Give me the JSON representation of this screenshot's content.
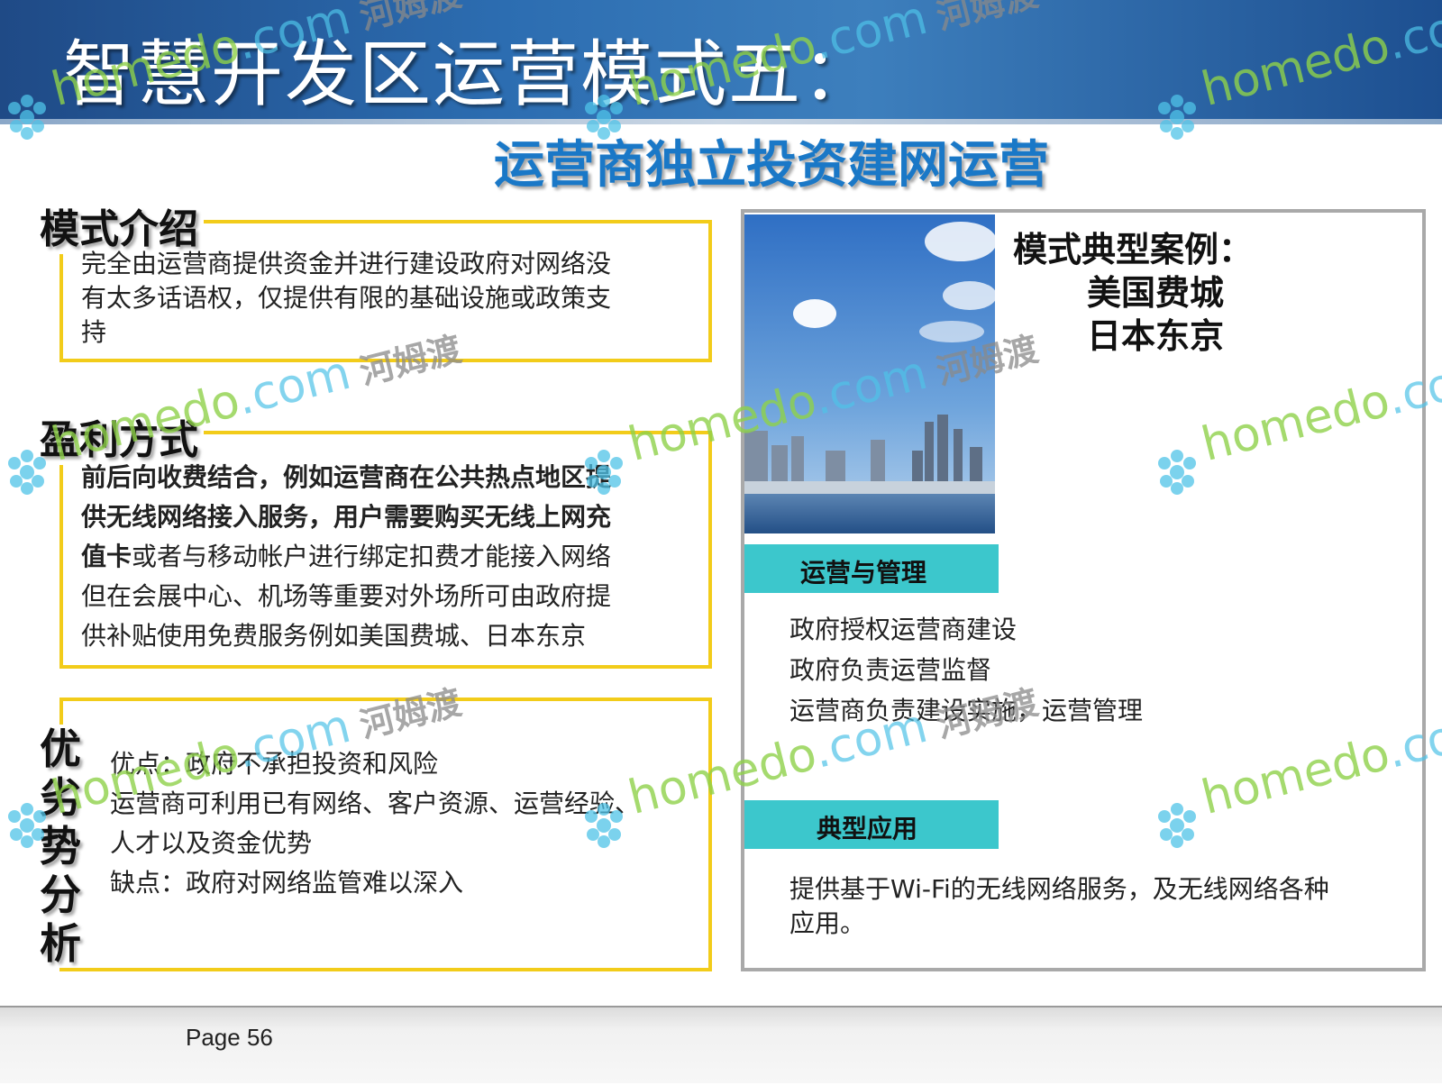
{
  "title": "智慧开发区运营模式五：",
  "subtitle": "运营商独立投资建网运营",
  "intro": {
    "label": "模式介绍",
    "lines": [
      "完全由运营商提供资金并进行建设政府对网络没",
      "有太多话语权，仅提供有限的基础设施或政策支",
      "持"
    ]
  },
  "profit": {
    "label": "盈利方式",
    "bold_lines": [
      "前后向收费结合，例如运营商在公共热点地区提",
      "供无线网络接入服务，用户需要购买无线上网充"
    ],
    "line3_bold": "值卡",
    "line3_rest": "或者与移动帐户进行绑定扣费才能接入网络",
    "lines": [
      "但在会展中心、机场等重要对外场所可由政府提",
      "供补贴使用免费服务例如美国费城、日本东京"
    ]
  },
  "analysis": {
    "label": "优劣势分析",
    "lines": [
      "优点：政府不承担投资和风险",
      "运营商可利用已有网络、客户资源、运营经验、",
      "人才以及资金优势",
      "缺点：政府对网络监管难以深入"
    ]
  },
  "cases": {
    "title": "模式典型案例：",
    "items": [
      "美国费城",
      "日本东京"
    ]
  },
  "operation": {
    "label": "运营与管理",
    "lines": [
      "政府授权运营商建设",
      "政府负责运营监督",
      "运营商负责建设实施，运营管理"
    ]
  },
  "application": {
    "label": "典型应用",
    "lines": [
      "提供基于Wi-Fi的无线网络服务，及无线网络各种",
      "应用。"
    ]
  },
  "watermark": {
    "brand": "homedo",
    "domain": ".com",
    "cn": "河姆渡"
  },
  "footer": {
    "page": "Page 56"
  }
}
